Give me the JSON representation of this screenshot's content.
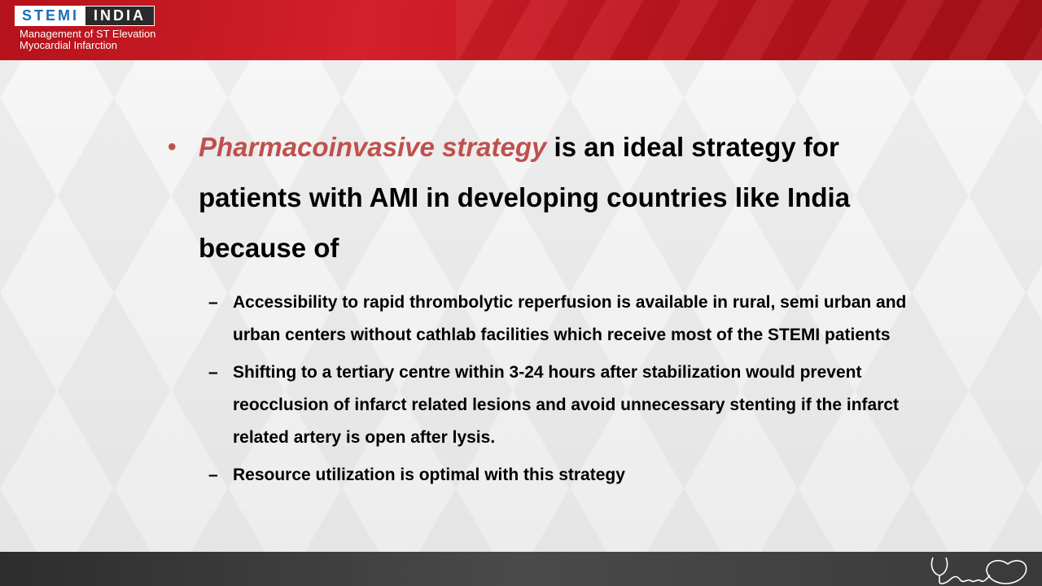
{
  "header": {
    "logo_left": "STEMI",
    "logo_right": "INDIA",
    "subtitle_line1": "Management of ST Elevation",
    "subtitle_line2": "Myocardial Infarction"
  },
  "main_bullet": {
    "emphasis": "Pharmacoinvasive strategy",
    "text": " is an ideal  strategy for patients with AMI in developing countries like India because of"
  },
  "sub_bullets": [
    "Accessibility to rapid thrombolytic reperfusion is available in rural, semi urban and urban centers without cathlab facilities which receive most of the STEMI patients",
    "Shifting to a tertiary centre within 3-24 hours after stabilization would prevent reocclusion of infarct related lesions and  avoid unnecessary stenting if the infarct related artery is open after lysis.",
    "Resource utilization is optimal with this strategy"
  ],
  "colors": {
    "accent": "#c0504d",
    "header_red": "#c8161f",
    "footer_dark": "#3a3a3a"
  },
  "icons": {
    "footer": "stethoscope-heart-icon"
  }
}
